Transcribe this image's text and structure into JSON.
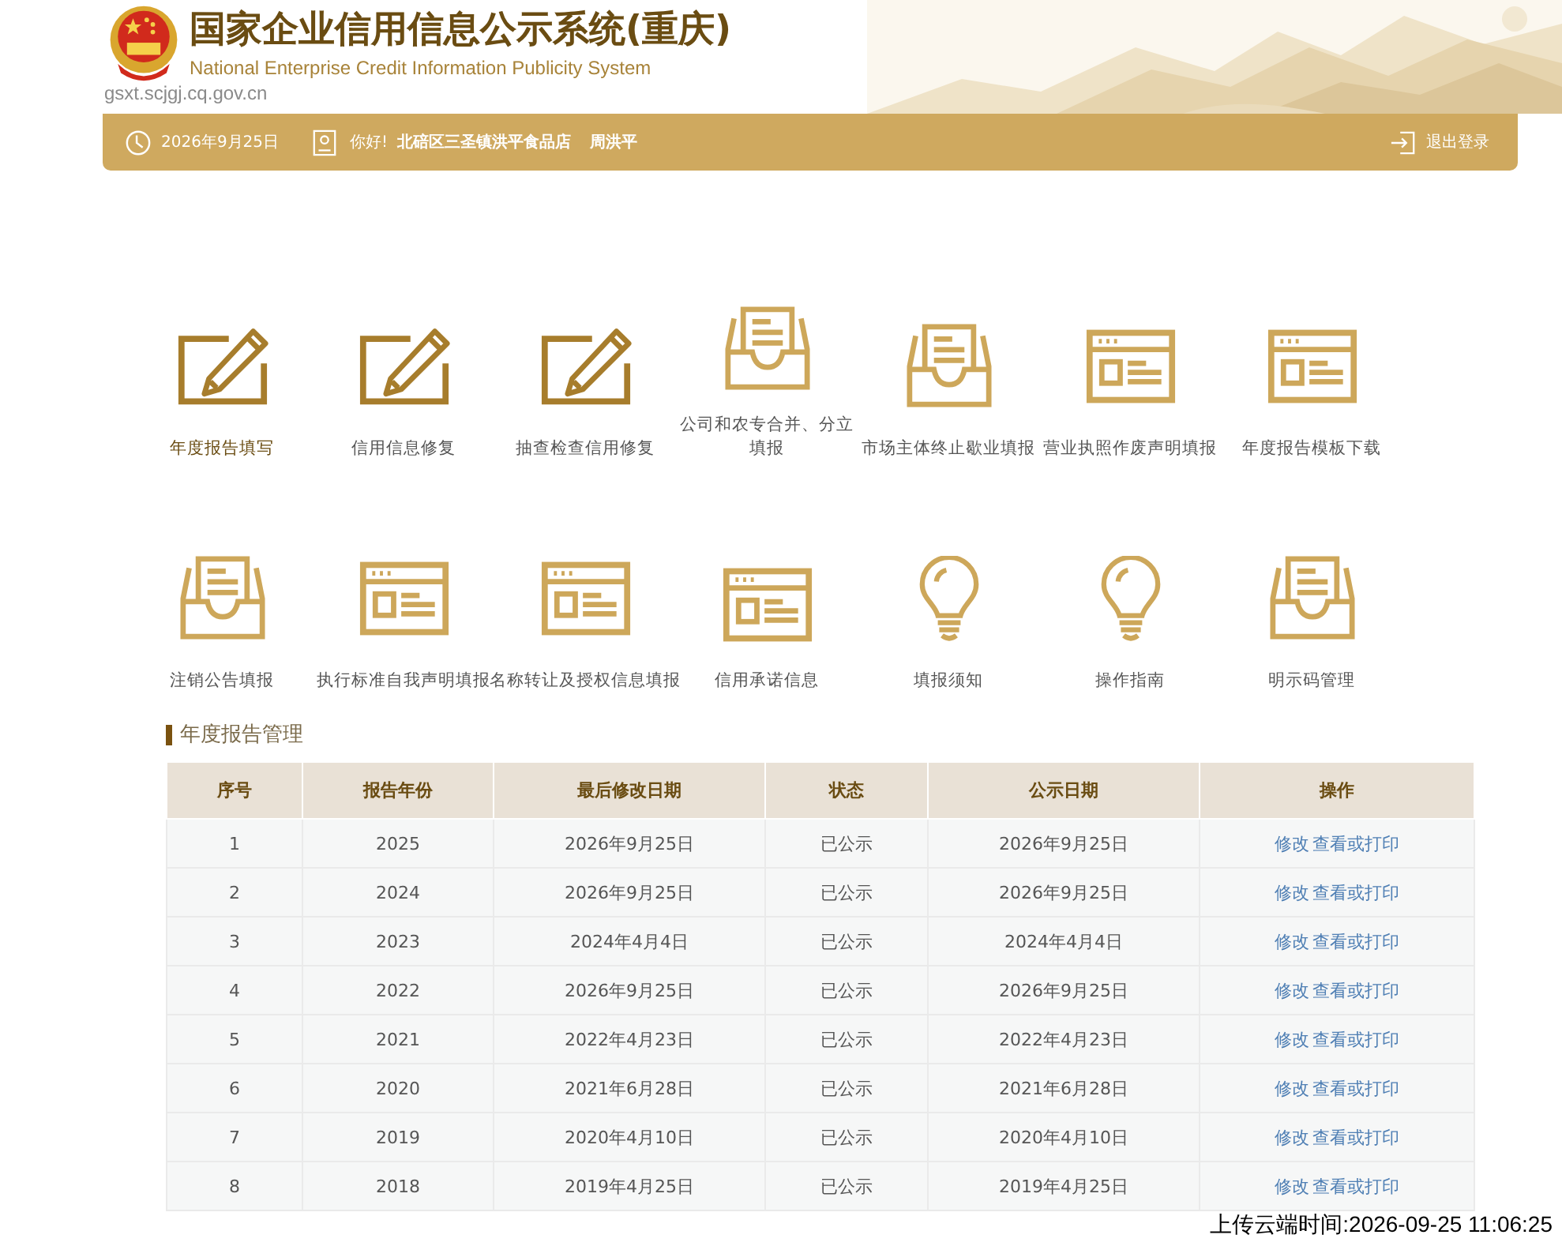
{
  "header": {
    "title": "国家企业信用信息公示系统(重庆)",
    "subtitle": "National Enterprise Credit Information Publicity System",
    "domain": "gsxt.scjgj.cq.gov.cn"
  },
  "info_bar": {
    "date": "2026年9月25日",
    "greeting": "你好!",
    "company": "北碚区三圣镇洪平食品店",
    "user": "周洪平",
    "logout": "退出登录"
  },
  "tile_rows": [
    [
      {
        "kind": "pencil",
        "label": "年度报告填写",
        "highlighted": true
      },
      {
        "kind": "pencil",
        "label": "信用信息修复",
        "highlighted": false
      },
      {
        "kind": "pencil",
        "label": "抽查检查信用修复",
        "highlighted": false
      },
      {
        "kind": "tray",
        "label": "公司和农专合并、分立填报",
        "highlighted": false
      },
      {
        "kind": "tray",
        "label": "市场主体终止歇业填报",
        "highlighted": false
      },
      {
        "kind": "window",
        "label": "营业执照作废声明填报",
        "highlighted": false
      },
      {
        "kind": "window",
        "label": "年度报告模板下载",
        "highlighted": false
      }
    ],
    [
      {
        "kind": "tray",
        "label": "注销公告填报",
        "highlighted": false
      },
      {
        "kind": "window",
        "label": "执行标准自我声明填报",
        "highlighted": false
      },
      {
        "kind": "window",
        "label": "名称转让及授权信息填报",
        "highlighted": false
      },
      {
        "kind": "window",
        "label": "信用承诺信息",
        "highlighted": false
      },
      {
        "kind": "bulb",
        "label": "填报须知",
        "highlighted": false
      },
      {
        "kind": "bulb",
        "label": "操作指南",
        "highlighted": false
      },
      {
        "kind": "tray",
        "label": "明示码管理",
        "highlighted": false
      }
    ]
  ],
  "section_title": "年度报告管理",
  "table": {
    "columns": [
      "序号",
      "报告年份",
      "最后修改日期",
      "状态",
      "公示日期",
      "操作"
    ],
    "rows": [
      {
        "cells": [
          "1",
          "2025",
          "2026年9月25日",
          "已公示",
          "2026年9月25日"
        ],
        "actions": [
          "修改",
          "查看或打印"
        ]
      },
      {
        "cells": [
          "2",
          "2024",
          "2026年9月25日",
          "已公示",
          "2026年9月25日"
        ],
        "actions": [
          "修改",
          "查看或打印"
        ]
      },
      {
        "cells": [
          "3",
          "2023",
          "2024年4月4日",
          "已公示",
          "2024年4月4日"
        ],
        "actions": [
          "修改",
          "查看或打印"
        ]
      },
      {
        "cells": [
          "4",
          "2022",
          "2026年9月25日",
          "已公示",
          "2026年9月25日"
        ],
        "actions": [
          "修改",
          "查看或打印"
        ]
      },
      {
        "cells": [
          "5",
          "2021",
          "2022年4月23日",
          "已公示",
          "2022年4月23日"
        ],
        "actions": [
          "修改",
          "查看或打印"
        ]
      },
      {
        "cells": [
          "6",
          "2020",
          "2021年6月28日",
          "已公示",
          "2021年6月28日"
        ],
        "actions": [
          "修改",
          "查看或打印"
        ]
      },
      {
        "cells": [
          "7",
          "2019",
          "2020年4月10日",
          "已公示",
          "2020年4月10日"
        ],
        "actions": [
          "修改",
          "查看或打印"
        ]
      },
      {
        "cells": [
          "8",
          "2018",
          "2019年4月25日",
          "已公示",
          "2019年4月25日"
        ],
        "actions": [
          "修改",
          "查看或打印"
        ]
      }
    ]
  },
  "upload_stamp": "上传云端时间:2026-09-25 11:06:25"
}
